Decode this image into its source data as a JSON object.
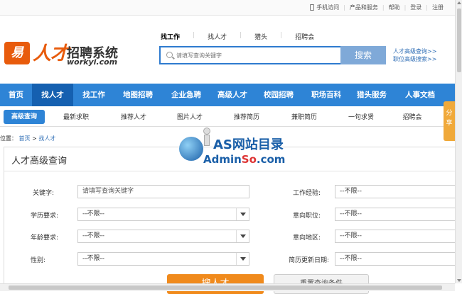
{
  "toplinks": {
    "mobile": "手机访问",
    "products": "产品和服务",
    "help": "帮助",
    "login": "登录",
    "register": "注册"
  },
  "logo": {
    "mark": "易",
    "name_a": "人才",
    "name_b": "招聘系统",
    "url": "workyi.com"
  },
  "search_tabs": [
    "找工作",
    "找人才",
    "猎头",
    "招聘会"
  ],
  "search": {
    "placeholder": "请填写查询关键字",
    "button": "搜索"
  },
  "right_links": [
    "人才高级查询>>",
    "职位高级搜索>>"
  ],
  "main_nav": [
    "首页",
    "找人才",
    "找工作",
    "地图招聘",
    "企业急聘",
    "高级人才",
    "校园招聘",
    "职场百科",
    "猎头服务",
    "人事文档"
  ],
  "sub_nav": [
    "高级查询",
    "最新求职",
    "推荐人才",
    "图片人才",
    "推荐简历",
    "兼职简历",
    "一句求贤",
    "招聘会"
  ],
  "share": "分享",
  "breadcrumb": {
    "prefix": "位置：",
    "home": "首页",
    "sep": ">",
    "current": "找人才"
  },
  "watermark": {
    "line1": "AS网站目录",
    "line2a": "Admin",
    "line2b": "So",
    "line2c": ".com"
  },
  "panel": {
    "title": "人才高级查询",
    "keyword_label": "关键字:",
    "keyword_placeholder": "请填写查询关键字",
    "education_label": "学历要求:",
    "education_value": "--不限--",
    "age_label": "年龄要求:",
    "age_value": "--不限--",
    "gender_label": "性别:",
    "gender_value": "--不限--",
    "experience_label": "工作经验:",
    "experience_value": "--不限--",
    "position_label": "意向职位:",
    "position_value": "--不限--",
    "region_label": "意向地区:",
    "region_value": "--不限--",
    "updated_label": "简历更新日期:",
    "updated_value": "--不限--",
    "search_button": "搜人才",
    "reset_button": "重置查询条件"
  }
}
